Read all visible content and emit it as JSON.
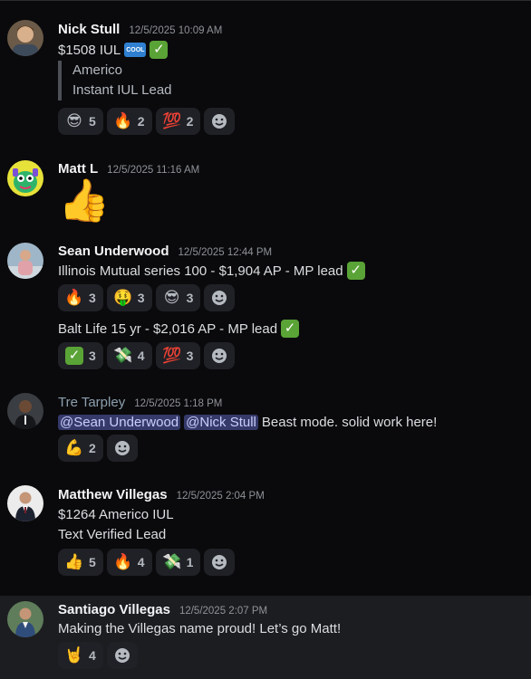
{
  "messages": [
    {
      "author": "Nick Stull",
      "time": "12/5/2025 10:09 AM",
      "text": "$1508 IUL",
      "badge": "COOL",
      "quote": [
        "Americo",
        "Instant IUL Lead"
      ],
      "reactions": [
        {
          "icon": "sunglasses-emoji",
          "emoji": "😎",
          "count": "5"
        },
        {
          "icon": "fire-emoji",
          "emoji": "🔥",
          "count": "2"
        },
        {
          "icon": "hundred-emoji",
          "emoji": "💯",
          "count": "2"
        }
      ]
    },
    {
      "author": "Matt L",
      "time": "12/5/2025 11:16 AM",
      "emoji": "👍"
    },
    {
      "author": "Sean Underwood",
      "time": "12/5/2025 12:44 PM",
      "posts": [
        {
          "text": "Illinois Mutual series 100 - $1,904 AP - MP lead",
          "reactions": [
            {
              "icon": "fire-emoji",
              "emoji": "🔥",
              "count": "3"
            },
            {
              "icon": "money-mouth-emoji",
              "emoji": "🤑",
              "count": "3"
            },
            {
              "icon": "sunglasses-emoji",
              "emoji": "😎",
              "count": "3"
            }
          ]
        },
        {
          "text": "Balt Life 15 yr - $2,016 AP - MP lead",
          "reactions": [
            {
              "icon": "check-emoji",
              "emoji": "✓",
              "count": "3"
            },
            {
              "icon": "money-wings-emoji",
              "emoji": "💸",
              "count": "4"
            },
            {
              "icon": "hundred-emoji",
              "emoji": "💯",
              "count": "3"
            }
          ]
        }
      ]
    },
    {
      "author": "Tre Tarpley",
      "time": "12/5/2025 1:18 PM",
      "mentions": [
        "@Sean Underwood",
        "@Nick Stull"
      ],
      "text": "Beast mode. solid work here!",
      "reactions": [
        {
          "icon": "flexed-biceps-emoji",
          "emoji": "💪",
          "count": "2"
        }
      ]
    },
    {
      "author": "Matthew Villegas",
      "time": "12/5/2025 2:04 PM",
      "lines": [
        "$1264 Americo IUL",
        "Text Verified Lead"
      ],
      "reactions": [
        {
          "icon": "thumbs-up-emoji",
          "emoji": "👍",
          "count": "5"
        },
        {
          "icon": "fire-emoji",
          "emoji": "🔥",
          "count": "4"
        },
        {
          "icon": "money-wings-emoji",
          "emoji": "💸",
          "count": "1"
        }
      ]
    },
    {
      "author": "Santiago Villegas",
      "time": "12/5/2025 2:07 PM",
      "text": "Making the Villegas name proud! Let’s go Matt!",
      "reactions": [
        {
          "icon": "rock-on-emoji",
          "emoji": "🤘",
          "count": "4"
        }
      ]
    }
  ],
  "colors": {
    "background": "#0a0a0c",
    "reaction_bg": "#202126",
    "mention_bg": "#353a6b",
    "check_green": "#5aa336"
  }
}
